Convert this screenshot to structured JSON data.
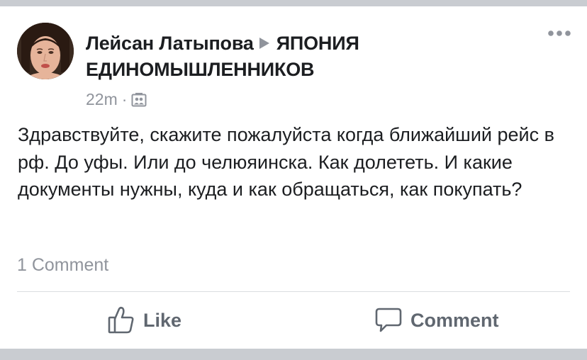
{
  "post": {
    "author": "Лейсан Латыпова",
    "group": "ЯПОНИЯ ЕДИНОМЫШЛЕННИКОВ",
    "time": "22m",
    "separator": "·",
    "audience_icon": "group-audience-icon",
    "text": "Здравствуйте, скажите пожалуйста когда ближайший рейс в рф. До уфы. Или до челюяинска. Как долететь. И какие документы нужны, куда и как обращаться, как покупать?",
    "comment_count": "1 Comment"
  },
  "actions": {
    "like_label": "Like",
    "comment_label": "Comment"
  },
  "colors": {
    "text_primary": "#1c1e21",
    "text_secondary": "#90949c",
    "action_text": "#606770",
    "band": "#c9ccd1"
  }
}
